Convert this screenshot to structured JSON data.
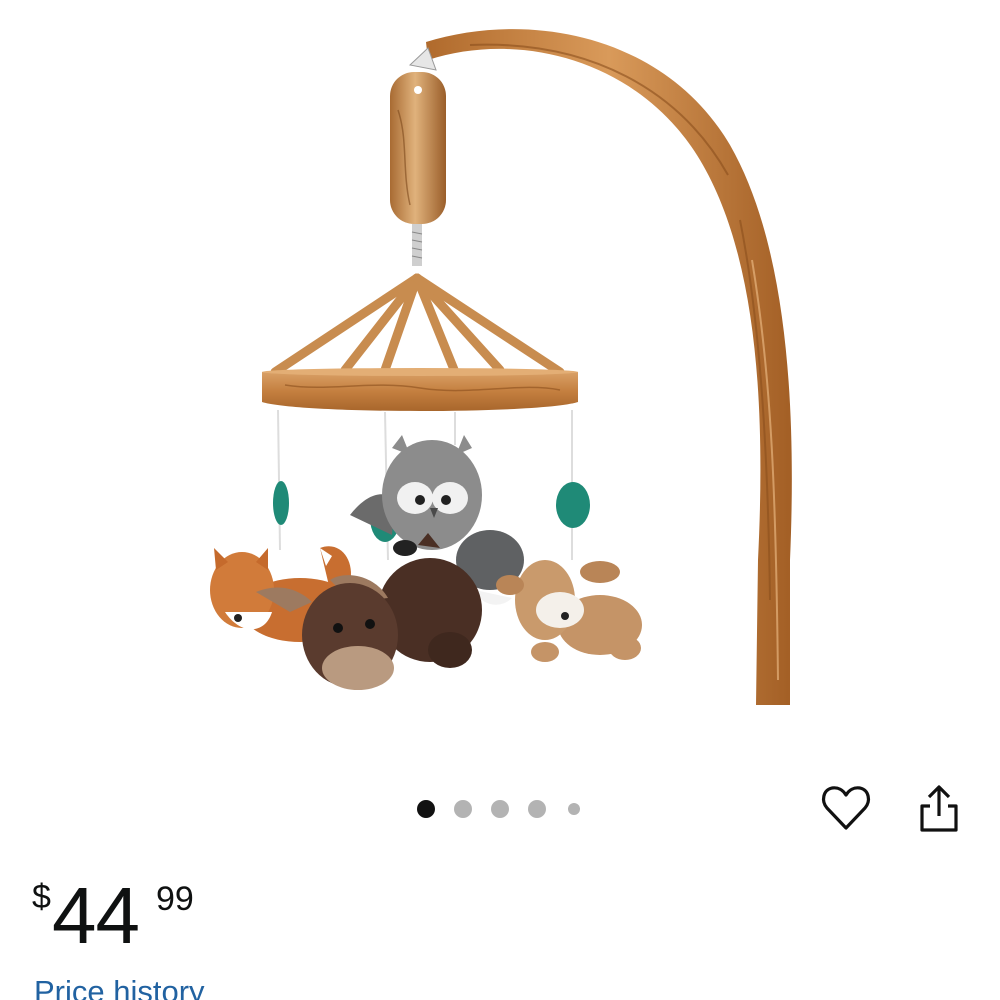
{
  "product": {
    "image_alt": "Woodland animals crib mobile"
  },
  "carousel": {
    "total": 5,
    "active_index": 0,
    "active_color": "#111111",
    "inactive_color": "#b3b3b3"
  },
  "actions": {
    "favorite_icon": "heart-icon",
    "share_icon": "share-icon"
  },
  "price": {
    "symbol": "$",
    "whole": "44",
    "fraction": "99"
  },
  "price_history": {
    "label": "Price history",
    "color": "#2162a1"
  }
}
